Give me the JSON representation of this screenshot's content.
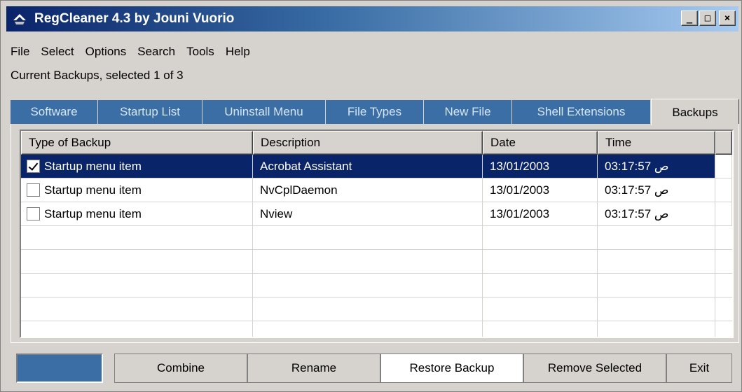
{
  "window": {
    "title": "RegCleaner 4.3 by Jouni Vuorio",
    "app_icon": "regcleaner-icon",
    "controls": {
      "minimize": "_",
      "maximize": "□",
      "close": "×"
    }
  },
  "menu": [
    "File",
    "Select",
    "Options",
    "Search",
    "Tools",
    "Help"
  ],
  "status_text": "Current Backups, selected 1 of 3",
  "tabs": [
    {
      "label": "Software"
    },
    {
      "label": "Startup List"
    },
    {
      "label": "Uninstall Menu"
    },
    {
      "label": "File Types"
    },
    {
      "label": "New File"
    },
    {
      "label": "Shell Extensions"
    },
    {
      "label": "Backups",
      "active": true
    }
  ],
  "table": {
    "columns": [
      "Type of Backup",
      "Description",
      "Date",
      "Time"
    ],
    "rows": [
      {
        "checked": true,
        "selected": true,
        "type": "Startup menu item",
        "description": "Acrobat Assistant",
        "date": "13/01/2003",
        "time": "03:17:57 ص"
      },
      {
        "checked": false,
        "selected": false,
        "type": "Startup menu item",
        "description": "NvCplDaemon",
        "date": "13/01/2003",
        "time": "03:17:57 ص"
      },
      {
        "checked": false,
        "selected": false,
        "type": "Startup menu item",
        "description": "Nview",
        "date": "13/01/2003",
        "time": "03:17:57 ص"
      }
    ]
  },
  "buttons": {
    "combine": "Combine",
    "rename": "Rename",
    "restore": "Restore Backup",
    "remove": "Remove Selected",
    "exit": "Exit"
  },
  "colors": {
    "title_start": "#0a246a",
    "tab_inactive": "#3a6ea5",
    "selection": "#0a246a",
    "face": "#d6d3ce"
  }
}
